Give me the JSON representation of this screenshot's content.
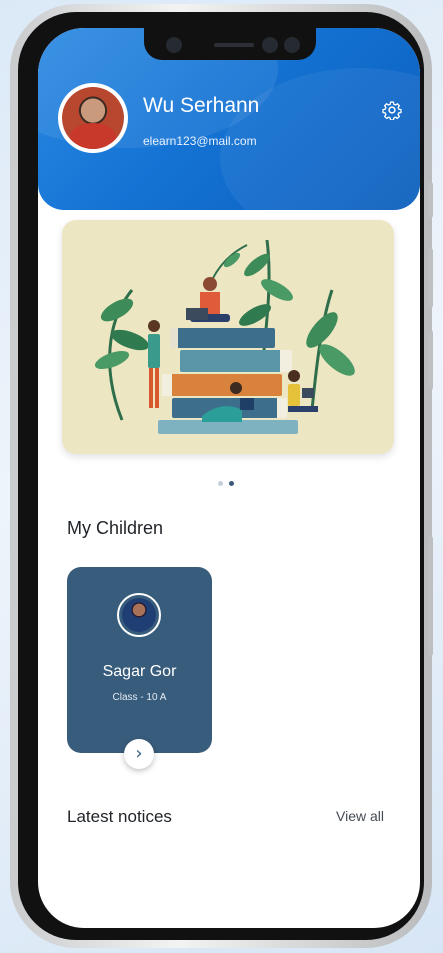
{
  "profile": {
    "name": "Wu Serhann",
    "email": "elearn123@mail.com"
  },
  "header": {
    "settings_icon": "gear-icon"
  },
  "banner": {
    "slides_total": 2,
    "active_slide": 2
  },
  "children_section": {
    "title": "My Children",
    "children": [
      {
        "name": "Sagar Gor",
        "class": "Class - 10 A"
      }
    ],
    "next_icon": "chevron-right-icon"
  },
  "notices_section": {
    "title": "Latest notices",
    "view_all_label": "View all"
  },
  "colors": {
    "header_blue": "#1473d4",
    "card_navy": "#385c7b",
    "banner_bg": "#ece6c3"
  }
}
